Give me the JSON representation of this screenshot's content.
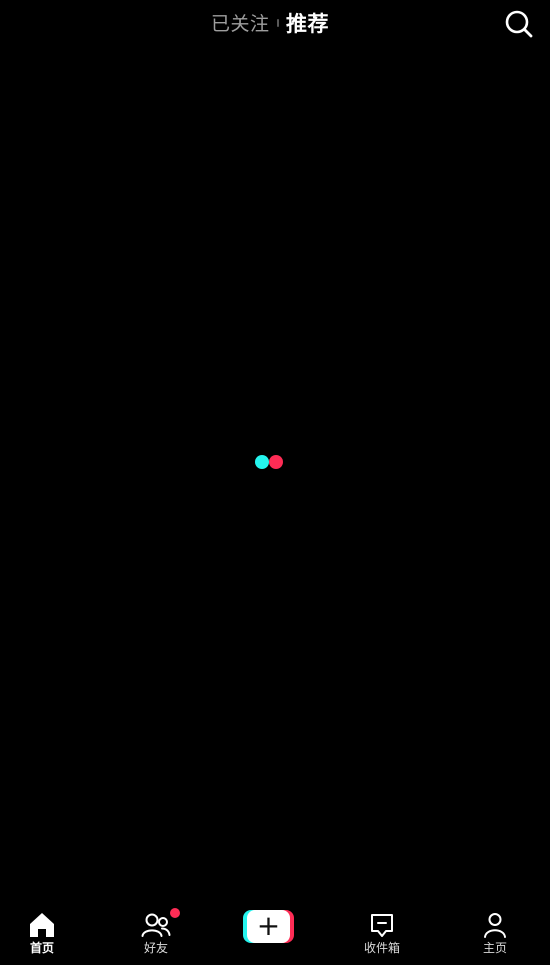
{
  "header": {
    "tab_following": "已关注",
    "tab_recommended": "推荐",
    "active_tab": "推荐",
    "search_icon": "search-icon"
  },
  "loader": {
    "colors": [
      "#25F4EE",
      "#FE2C55"
    ]
  },
  "bottom_nav": {
    "items": [
      {
        "label": "首页",
        "icon": "home-icon",
        "active": true
      },
      {
        "label": "好友",
        "icon": "friends-icon",
        "active": false,
        "has_badge": true
      },
      {
        "label": "",
        "icon": "create-plus-icon",
        "active": false
      },
      {
        "label": "收件箱",
        "icon": "inbox-icon",
        "active": false
      },
      {
        "label": "主页",
        "icon": "profile-icon",
        "active": false
      }
    ],
    "create_symbol": "+"
  },
  "colors": {
    "background": "#000000",
    "accent_cyan": "#25F4EE",
    "accent_red": "#FE2C55",
    "badge": "#FE2C55"
  }
}
